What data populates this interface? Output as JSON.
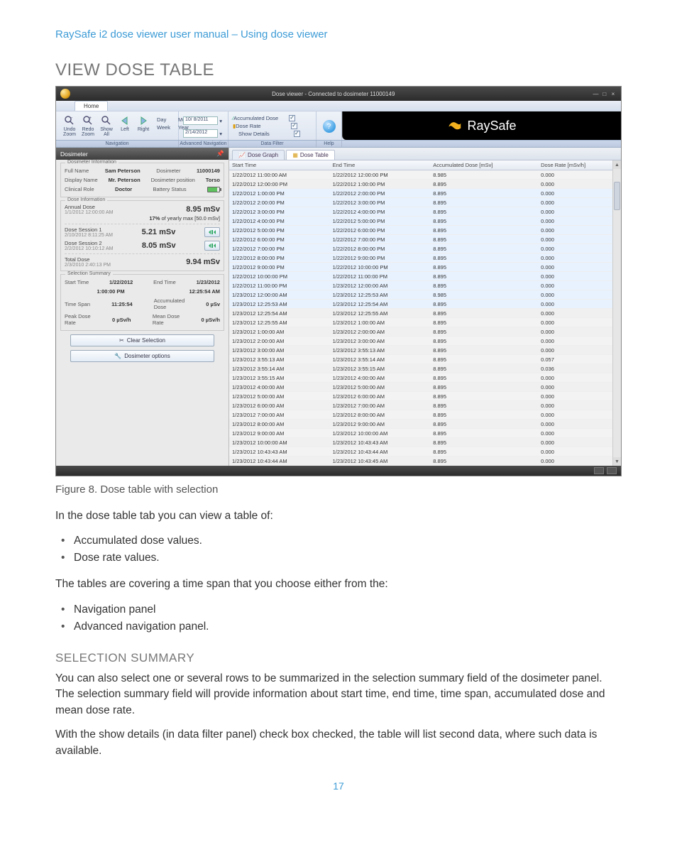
{
  "doc": {
    "header": "RaySafe i2 dose viewer user manual – Using dose viewer",
    "h1": "VIEW DOSE TABLE",
    "figcap": "Figure 8.    Dose table with selection",
    "p1": "In the dose table tab you can view a table of:",
    "list1": [
      "Accumulated dose values.",
      "Dose rate values."
    ],
    "p2": "The tables are covering a time span that you choose either from the:",
    "list2": [
      "Navigation panel",
      "Advanced navigation panel."
    ],
    "h2": "SELECTION SUMMARY",
    "p3": "You can also select one or several rows to be summarized in the selection summary field of the dosimeter panel. The selection summary field will provide information about start time, end time, time span, accumulated dose and mean dose rate.",
    "p4": "With the show details (in data filter panel) check box checked, the table will list second data, where such data is available.",
    "pagenum": "17"
  },
  "app": {
    "title": "Dose viewer - Connected to dosimeter 11000149",
    "tabs": {
      "home": "Home"
    },
    "brand": "RaySafe",
    "ribbon": {
      "nav": {
        "undo_zoom": "Undo\nZoom",
        "redo_zoom": "Redo\nZoom",
        "show_all": "Show\nAll",
        "left": "Left",
        "right": "Right",
        "day": "Day",
        "month": "Month",
        "week": "Week",
        "year": "Year",
        "caption": "Navigation"
      },
      "adv": {
        "date1": "10/ 8/2011",
        "date2": "2/14/2012",
        "caption": "Advanced Navigation"
      },
      "filter": {
        "accum": "Accumulated Dose",
        "rate": "Dose Rate",
        "details": "Show Details",
        "caption": "Data Filter"
      },
      "help": {
        "caption": "Help"
      }
    },
    "panel": {
      "title": "Dosimeter",
      "info": {
        "legend": "Dosimeter Information",
        "full_name_k": "Full Name",
        "full_name_v": "Sam Peterson",
        "dosimeter_k": "Dosimeter",
        "dosimeter_v": "11000149",
        "display_k": "Display Name",
        "display_v": "Mr. Peterson",
        "pos_k": "Dosimeter position",
        "pos_v": "Torso",
        "role_k": "Clinical Role",
        "role_v": "Doctor",
        "batt_k": "Battery Status"
      },
      "dose": {
        "legend": "Dose Information",
        "annual_h": "Annual Dose",
        "annual_t": "1/1/2012 12:00:00 AM",
        "annual_v": "8.95 mSv",
        "annual_pct": "17%",
        "annual_pct_sfx": "of yearly max [50.0 mSv]",
        "s1_h": "Dose Session 1",
        "s1_t": "2/10/2012 8:11:25 AM",
        "s1_v": "5.21 mSv",
        "s2_h": "Dose Session 2",
        "s2_t": "2/2/2012 10:10:12 AM",
        "s2_v": "8.05 mSv",
        "tot_h": "Total Dose",
        "tot_t": "2/3/2010 2:40:13 PM",
        "tot_v": "9.94 mSv"
      },
      "sel": {
        "legend": "Selection Summary",
        "start_k": "Start Time",
        "start_v1": "1/22/2012",
        "start_v2": "1:00:00 PM",
        "end_k": "End Time",
        "end_v1": "1/23/2012",
        "end_v2": "12:25:54 AM",
        "span_k": "Time Span",
        "span_v": "11:25:54",
        "accum_k": "Accumulated\nDose",
        "accum_v": "0 µSv",
        "peak_k": "Peak Dose\nRate",
        "peak_v": "0 µSv/h",
        "mean_k": "Mean Dose\nRate",
        "mean_v": "0 µSv/h"
      },
      "btn_clear": "Clear Selection",
      "btn_opts": "Dosimeter options"
    },
    "table": {
      "tab_graph": "Dose Graph",
      "tab_table": "Dose Table",
      "cols": [
        "Start Time",
        "End Time",
        "Accumulated Dose [mSv]",
        "Dose Rate [mSv/h]"
      ],
      "rows": [
        [
          "1/22/2012 11:00:00 AM",
          "1/22/2012 12:00:00 PM",
          "8.985",
          "0.000"
        ],
        [
          "1/22/2012 12:00:00 PM",
          "1/22/2012 1:00:00 PM",
          "8.895",
          "0.000"
        ],
        [
          "1/22/2012 1:00:00 PM",
          "1/22/2012 2:00:00 PM",
          "8.895",
          "0.000"
        ],
        [
          "1/22/2012 2:00:00 PM",
          "1/22/2012 3:00:00 PM",
          "8.895",
          "0.000"
        ],
        [
          "1/22/2012 3:00:00 PM",
          "1/22/2012 4:00:00 PM",
          "8.895",
          "0.000"
        ],
        [
          "1/22/2012 4:00:00 PM",
          "1/22/2012 5:00:00 PM",
          "8.895",
          "0.000"
        ],
        [
          "1/22/2012 5:00:00 PM",
          "1/22/2012 6:00:00 PM",
          "8.895",
          "0.000"
        ],
        [
          "1/22/2012 6:00:00 PM",
          "1/22/2012 7:00:00 PM",
          "8.895",
          "0.000"
        ],
        [
          "1/22/2012 7:00:00 PM",
          "1/22/2012 8:00:00 PM",
          "8.895",
          "0.000"
        ],
        [
          "1/22/2012 8:00:00 PM",
          "1/22/2012 9:00:00 PM",
          "8.895",
          "0.000"
        ],
        [
          "1/22/2012 9:00:00 PM",
          "1/22/2012 10:00:00 PM",
          "8.895",
          "0.000"
        ],
        [
          "1/22/2012 10:00:00 PM",
          "1/22/2012 11:00:00 PM",
          "8.895",
          "0.000"
        ],
        [
          "1/22/2012 11:00:00 PM",
          "1/23/2012 12:00:00 AM",
          "8.895",
          "0.000"
        ],
        [
          "1/23/2012 12:00:00 AM",
          "1/23/2012 12:25:53 AM",
          "8.985",
          "0.000"
        ],
        [
          "1/23/2012 12:25:53 AM",
          "1/23/2012 12:25:54 AM",
          "8.895",
          "0.000"
        ],
        [
          "1/23/2012 12:25:54 AM",
          "1/23/2012 12:25:55 AM",
          "8.895",
          "0.000"
        ],
        [
          "1/23/2012 12:25:55 AM",
          "1/23/2012 1:00:00 AM",
          "8.895",
          "0.000"
        ],
        [
          "1/23/2012 1:00:00 AM",
          "1/23/2012 2:00:00 AM",
          "8.895",
          "0.000"
        ],
        [
          "1/23/2012 2:00:00 AM",
          "1/23/2012 3:00:00 AM",
          "8.895",
          "0.000"
        ],
        [
          "1/23/2012 3:00:00 AM",
          "1/23/2012 3:55:13 AM",
          "8.895",
          "0.000"
        ],
        [
          "1/23/2012 3:55:13 AM",
          "1/23/2012 3:55:14 AM",
          "8.895",
          "0.057"
        ],
        [
          "1/23/2012 3:55:14 AM",
          "1/23/2012 3:55:15 AM",
          "8.895",
          "0.036"
        ],
        [
          "1/23/2012 3:55:15 AM",
          "1/23/2012 4:00:00 AM",
          "8.895",
          "0.000"
        ],
        [
          "1/23/2012 4:00:00 AM",
          "1/23/2012 5:00:00 AM",
          "8.895",
          "0.000"
        ],
        [
          "1/23/2012 5:00:00 AM",
          "1/23/2012 6:00:00 AM",
          "8.895",
          "0.000"
        ],
        [
          "1/23/2012 6:00:00 AM",
          "1/23/2012 7:00:00 AM",
          "8.895",
          "0.000"
        ],
        [
          "1/23/2012 7:00:00 AM",
          "1/23/2012 8:00:00 AM",
          "8.895",
          "0.000"
        ],
        [
          "1/23/2012 8:00:00 AM",
          "1/23/2012 9:00:00 AM",
          "8.895",
          "0.000"
        ],
        [
          "1/23/2012 9:00:00 AM",
          "1/23/2012 10:00:00 AM",
          "8.895",
          "0.000"
        ],
        [
          "1/23/2012 10:00:00 AM",
          "1/23/2012 10:43:43 AM",
          "8.895",
          "0.000"
        ],
        [
          "1/23/2012 10:43:43 AM",
          "1/23/2012 10:43:44 AM",
          "8.895",
          "0.000"
        ],
        [
          "1/23/2012 10:43:44 AM",
          "1/23/2012 10:43:45 AM",
          "8.895",
          "0.000"
        ]
      ],
      "selected_from": 2,
      "selected_to": 14
    }
  }
}
